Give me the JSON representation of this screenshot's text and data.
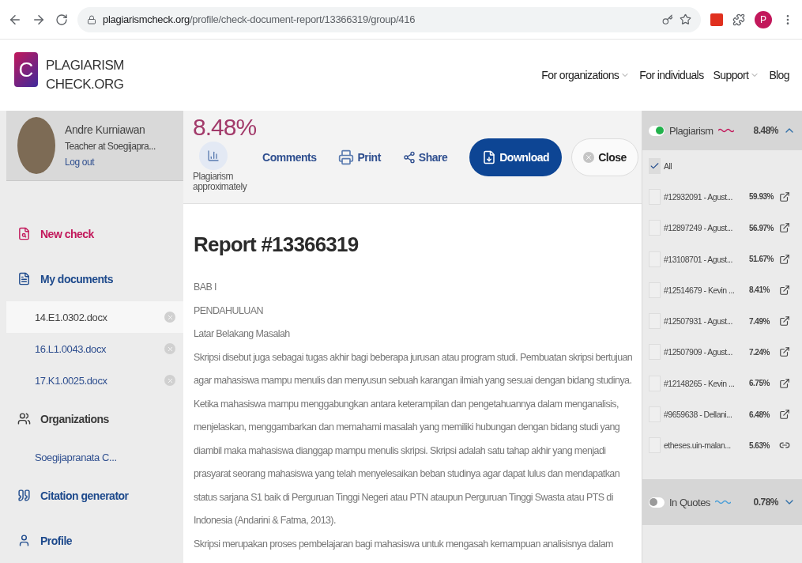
{
  "browser": {
    "url_host": "plagiarismcheck.org",
    "url_path": "/profile/check-document-report/13366319/group/416",
    "profile_initial": "P"
  },
  "site": {
    "logo_lines": [
      "PLAGIARISM",
      "CHECK.ORG"
    ],
    "logo_letter": "C",
    "nav": [
      {
        "label": "For organizations",
        "dropdown": true
      },
      {
        "label": "For individuals",
        "dropdown": false
      },
      {
        "label": "Support",
        "dropdown": true
      },
      {
        "label": "Blog",
        "dropdown": false
      }
    ]
  },
  "user": {
    "name": "Andre Kurniawan",
    "role": "Teacher at Soegijapra...",
    "logout": "Log out"
  },
  "sidebar": {
    "items": [
      {
        "label": "New check",
        "color": "#c2185b"
      },
      {
        "label": "My documents",
        "color": "#1e4a8c",
        "children": [
          {
            "label": "14.E1.0302.docx",
            "selected": true,
            "removable": true
          },
          {
            "label": "16.L1.0043.docx",
            "selected": false,
            "removable": true
          },
          {
            "label": "17.K1.0025.docx",
            "selected": false,
            "removable": true
          }
        ]
      },
      {
        "label": "Organizations",
        "color": "#3a3a3a",
        "children": [
          {
            "label": "Soegijapranata C...",
            "selected": false,
            "removable": false
          }
        ]
      },
      {
        "label": "Citation generator",
        "color": "#1e4a8c"
      },
      {
        "label": "Profile",
        "color": "#1e4a8c"
      }
    ]
  },
  "summary": {
    "percent": "8.48%",
    "caption": "Plagiarism approximately"
  },
  "toolbar": [
    {
      "label": "Comments",
      "kind": "link"
    },
    {
      "label": "Print",
      "kind": "print"
    },
    {
      "label": "Share",
      "kind": "share"
    },
    {
      "label": "Download",
      "kind": "primary"
    },
    {
      "label": "Close",
      "kind": "close"
    }
  ],
  "report": {
    "title": "Report #13366319",
    "lines": [
      "BAB I",
      "PENDAHULUAN",
      "Latar Belakang Masalah",
      "Skripsi disebut juga sebagai tugas akhir bagi beberapa jurusan atau program studi. Pembuatan skripsi bertujuan",
      "agar mahasiswa mampu menulis dan menyusun sebuah karangan ilmiah yang sesuai dengan bidang studinya.",
      "Ketika mahasiswa mampu menggabungkan antara keterampilan dan pengetahuannya dalam menganalisis,",
      "menjelaskan, menggambarkan dan memahami masalah yang memiliki hubungan dengan bidang studi yang",
      "diambil maka mahasiswa dianggap mampu menulis skripsi. Skripsi adalah satu tahap akhir yang menjadi",
      "prasyarat seorang mahasiswa yang telah menyelesaikan beban studinya agar dapat lulus dan mendapatkan",
      "status sarjana S1 baik di Perguruan Tinggi Negeri atau PTN ataupun Perguruan Tinggi Swasta atau PTS di",
      "Indonesia (Andarini & Fatma, 2013).",
      "Skripsi merupakan proses pembelajaran bagi mahasiswa untuk mengasah kemampuan analisisnya dalam"
    ]
  },
  "sources": {
    "groups": [
      {
        "label": "Plagiarism",
        "percent": "8.48%",
        "on": true,
        "expanded": true,
        "color": "#c2185b",
        "all": {
          "label": "All",
          "checked": true
        },
        "items": [
          {
            "label": "#12932091 - Agust...",
            "percent": "59.93%",
            "checked": false,
            "kind": "document"
          },
          {
            "label": "#12897249 - Agust...",
            "percent": "56.97%",
            "checked": false,
            "kind": "document"
          },
          {
            "label": "#13108701 - Agust...",
            "percent": "51.67%",
            "checked": false,
            "kind": "document"
          },
          {
            "label": "#12514679 - Kevin ...",
            "percent": "8.41%",
            "checked": false,
            "kind": "document"
          },
          {
            "label": "#12507931 - Agust...",
            "percent": "7.49%",
            "checked": false,
            "kind": "document"
          },
          {
            "label": "#12507909 - Agust...",
            "percent": "7.24%",
            "checked": false,
            "kind": "document"
          },
          {
            "label": "#12148265 - Kevin ...",
            "percent": "6.75%",
            "checked": false,
            "kind": "document"
          },
          {
            "label": "#9659638 - Dellani...",
            "percent": "6.48%",
            "checked": false,
            "kind": "document"
          },
          {
            "label": "etheses.uin-malan...",
            "percent": "5.63%",
            "checked": false,
            "kind": "web"
          }
        ]
      },
      {
        "label": "In Quotes",
        "percent": "0.78%",
        "on": false,
        "expanded": false,
        "color": "#4a9fd8"
      }
    ]
  }
}
